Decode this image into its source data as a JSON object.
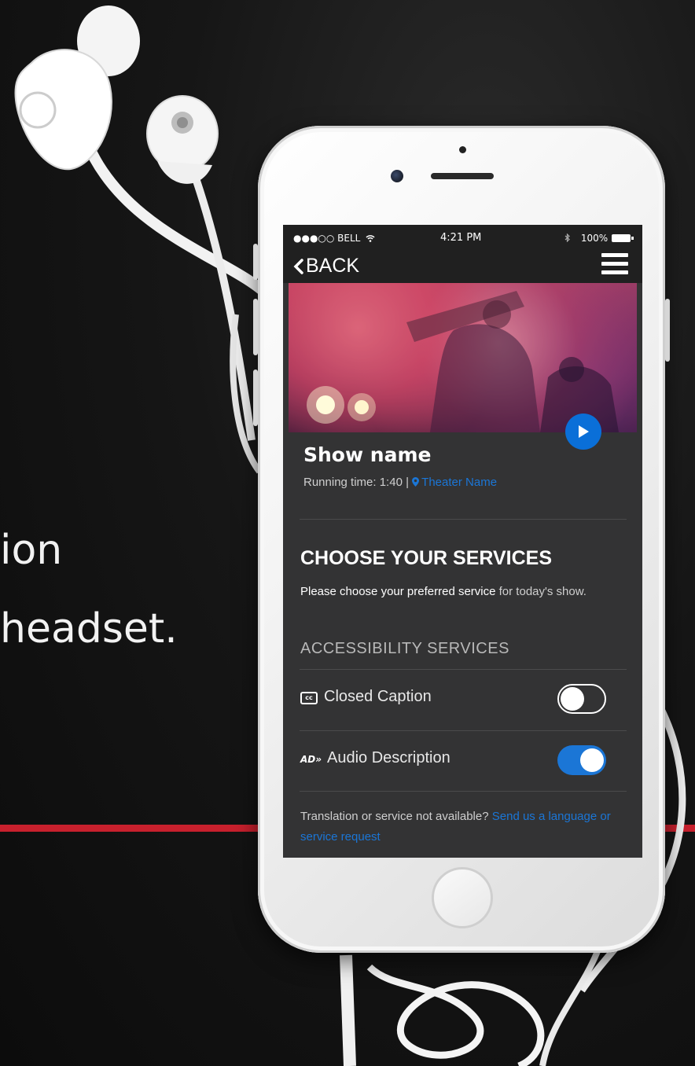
{
  "background": {
    "line1": "ion",
    "line2": "headset.",
    "accent_color": "#c8202d"
  },
  "status_bar": {
    "carrier": "●●●○○ BELL",
    "time": "4:21 PM",
    "battery": "100%",
    "icons": [
      "wifi-icon",
      "bluetooth-icon",
      "battery-icon"
    ]
  },
  "nav": {
    "back_label": "BACK",
    "menu_icon": "hamburger-menu-icon"
  },
  "show": {
    "title": "Show name",
    "running_time": "Running time: 1:40 | ",
    "theater": "Theater Name",
    "play_icon": "play-icon"
  },
  "services": {
    "title": "CHOOSE YOUR SERVICES",
    "desc_bold": "Please choose your preferred service",
    "desc_rest": " for today's show.",
    "section_title": "ACCESSIBILITY SERVICES",
    "items": [
      {
        "label": "Closed Caption",
        "icon": "cc-icon",
        "icon_text": "cc",
        "enabled": false
      },
      {
        "label": "Audio Description",
        "icon": "audio-description-icon",
        "icon_text": "AD»",
        "enabled": true
      }
    ]
  },
  "footer": {
    "text": "Translation or service not available? ",
    "link": "Send us a language or service request"
  },
  "colors": {
    "accent_blue": "#1b76d6",
    "screen_bg": "#333334",
    "bar_bg": "#202020"
  }
}
